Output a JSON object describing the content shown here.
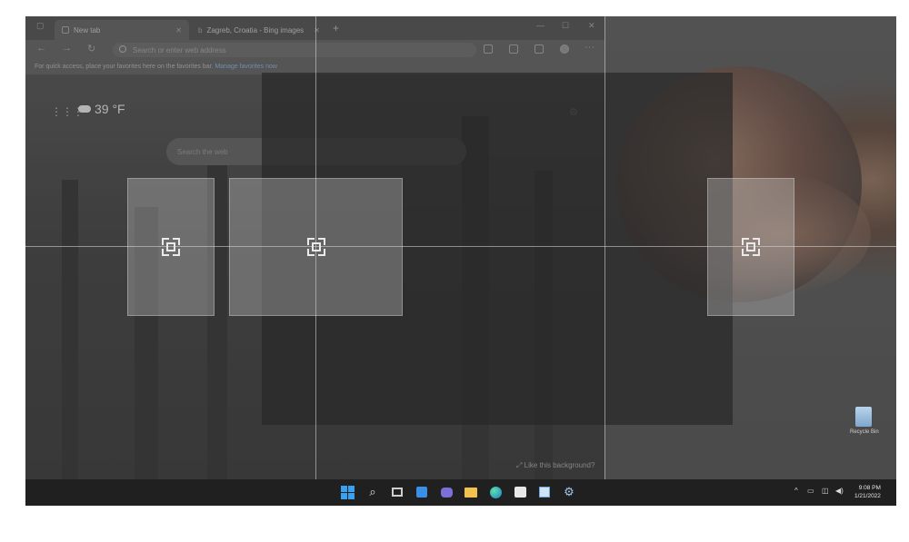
{
  "browser": {
    "tabs": [
      {
        "label": "New tab",
        "active": true
      },
      {
        "label": "Zagreb, Croatia - Bing images",
        "active": false
      }
    ],
    "address_placeholder": "Search or enter web address",
    "favorites_bar_text": "For quick access, place your favorites here on the favorites bar.",
    "favorites_bar_link": "Manage favorites now"
  },
  "new_tab_page": {
    "temperature": "39 °F",
    "search_placeholder": "Search the web",
    "like_background": "Like this background?"
  },
  "desktop": {
    "recycle_bin_label": "Recycle Bin"
  },
  "taskbar": {
    "time": "9:08 PM",
    "date": "1/21/2022"
  },
  "colors": {
    "taskbar_bg": "#202020",
    "start_blue": "#3aa0f0",
    "snap_zone": "#d2d2d2"
  }
}
